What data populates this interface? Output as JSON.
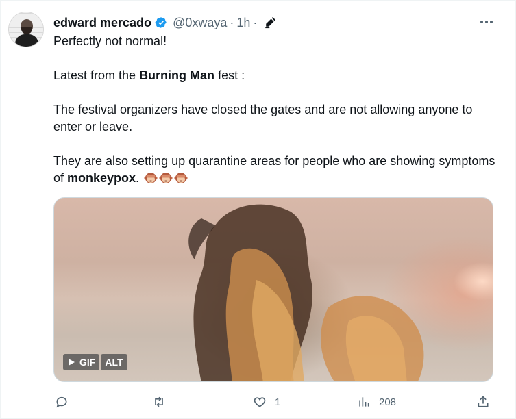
{
  "tweet": {
    "author_name": "edward mercado",
    "handle": "@0xwaya",
    "separator": "·",
    "time": "1h",
    "separator2": "·",
    "line1": "Perfectly not normal!",
    "line2_pre": "Latest from the ",
    "line2_bold": "Burning Man",
    "line2_post": " fest :",
    "line3": "The festival organizers have closed the gates and are not allowing anyone to enter or leave.",
    "line4_pre": "They are also setting up quarantine areas for people who are showing symptoms of ",
    "line4_bold": "monkeypox",
    "line4_post": ". ",
    "emoji_name": "see-no-evil-monkey",
    "emoji_count": 3,
    "verified_color": "#1d9bf0"
  },
  "media": {
    "gif_label": "GIF",
    "alt_label": "ALT",
    "icon": "play-icon"
  },
  "actions": {
    "reply_icon": "reply-icon",
    "retweet_icon": "retweet-icon",
    "like_icon": "like-icon",
    "like_count": "1",
    "views_icon": "views-icon",
    "views_count": "208",
    "share_icon": "share-icon"
  }
}
